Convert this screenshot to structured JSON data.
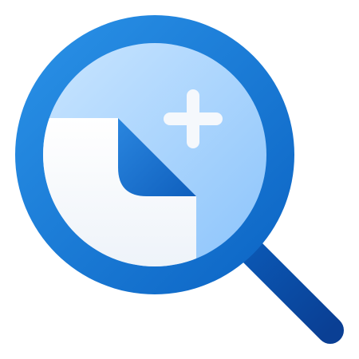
{
  "icon": {
    "name": "zoom-in-document-icon",
    "colors": {
      "ring": "#1f84dc",
      "ring_dark": "#0b63c3",
      "lens": "#b9dcff",
      "lens_deep": "#8cc4fb",
      "document": "#f5f8fc",
      "document_shadow": "#e7eef7",
      "document_fold": "#1d74d2",
      "plus": "#f5f8fc",
      "handle_top": "#0b5ab7",
      "handle_bottom": "#0a3f94"
    }
  }
}
